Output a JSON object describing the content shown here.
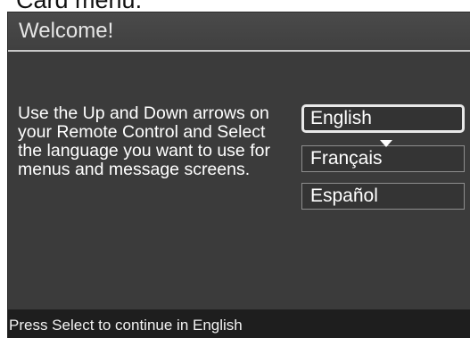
{
  "page_caption": "Card menu.",
  "screen": {
    "title": "Welcome!",
    "instructions": "Use the Up and Down arrows on your Remote Control and Select the language you want to use for menus and message screens.",
    "languages": [
      {
        "label": "English",
        "selected": true
      },
      {
        "label": "Français",
        "selected": false
      },
      {
        "label": "Español",
        "selected": false
      }
    ],
    "scroll_indicator_icon": "down-arrow-icon",
    "footer": "Press Select to continue in English"
  },
  "colors": {
    "screen_background": "#3b3b3b",
    "footer_background": "#1e1e1e",
    "text": "#ffffff",
    "selected_border": "#e9e9e9"
  }
}
